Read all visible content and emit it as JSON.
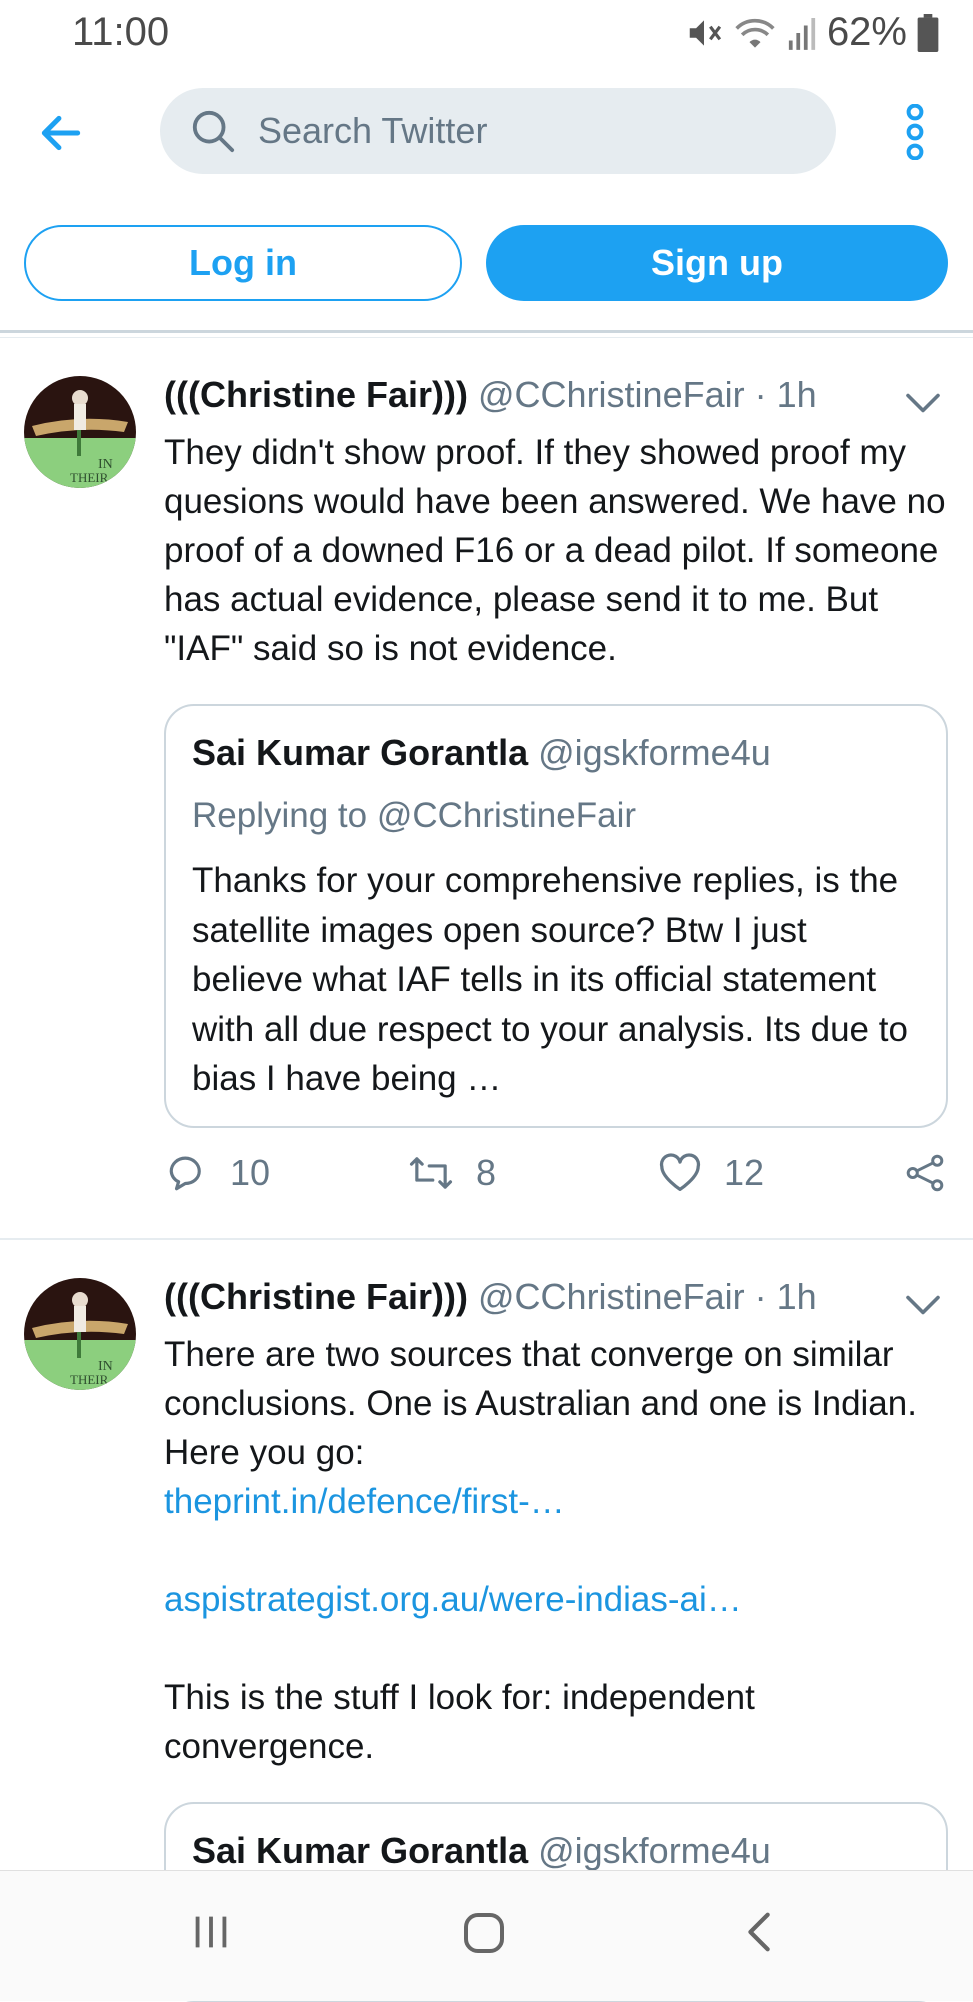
{
  "status_bar": {
    "time": "11:00",
    "battery": "62%",
    "icons": [
      "mute-icon",
      "wifi-icon",
      "signal-icon",
      "battery-icon"
    ]
  },
  "search": {
    "placeholder": "Search Twitter"
  },
  "auth": {
    "login_label": "Log in",
    "signup_label": "Sign up"
  },
  "colors": {
    "accent": "#1da1f2",
    "link": "#1b95e0",
    "muted": "#657786",
    "border": "#ccd6dd"
  },
  "tweets": [
    {
      "name": "(((Christine Fair)))",
      "handle": "@CChristineFair",
      "dot": "·",
      "time": "1h",
      "text": "They didn't show proof. If they showed proof my quesions would have been answered. We have no proof of a downed F16 or a dead pilot. If someone has actual evidence, please send it to me. But \"IAF\" said so is not evidence.",
      "quote": {
        "name": "Sai Kumar Gorantla",
        "handle": "@igskforme4u",
        "replying": "Replying to @CChristineFair",
        "text": "Thanks for your comprehensive replies, is the satellite images open source? Btw I just believe what IAF tells in its official statement with all due respect to your analysis. Its due to bias I have being …"
      },
      "replies": "10",
      "retweets": "8",
      "likes": "12"
    },
    {
      "name": "(((Christine Fair)))",
      "handle": "@CChristineFair",
      "dot": "·",
      "time": "1h",
      "text": "There are two sources that converge on similar conclusions. One is Australian and one is Indian. Here you go:",
      "link1": "theprint.in/defence/first-…",
      "link2": "aspistrategist.org.au/were-indias-ai…",
      "text2": "This is the stuff I look for: independent convergence.",
      "quote": {
        "name": "Sai Kumar Gorantla",
        "handle": "@igskforme4u"
      }
    }
  ]
}
